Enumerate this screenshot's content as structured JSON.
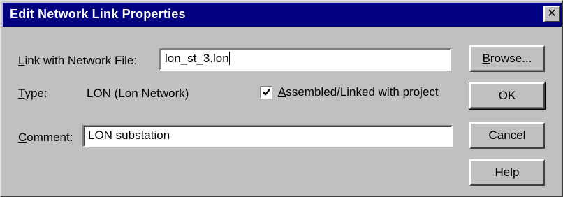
{
  "window": {
    "title": "Edit Network Link Properties",
    "close_glyph": "✕"
  },
  "form": {
    "link_label_mnemonic": "L",
    "link_label_rest": "ink with Network File:",
    "link_value": "lon_st_3.lon",
    "type_label_mnemonic": "T",
    "type_label_rest": "ype:",
    "type_value": "LON (Lon Network)",
    "assembled_checked": true,
    "assembled_label_mnemonic": "A",
    "assembled_label_rest": "ssembled/Linked with project",
    "comment_label_mnemonic": "C",
    "comment_label_rest": "omment:",
    "comment_value": "LON substation"
  },
  "buttons": {
    "browse_mnemonic": "B",
    "browse_rest": "rowse...",
    "ok_label": "OK",
    "cancel_label": "Cancel",
    "help_mnemonic": "H",
    "help_rest": "elp"
  },
  "icons": {
    "close": "close-icon",
    "check": "checkmark-icon"
  }
}
